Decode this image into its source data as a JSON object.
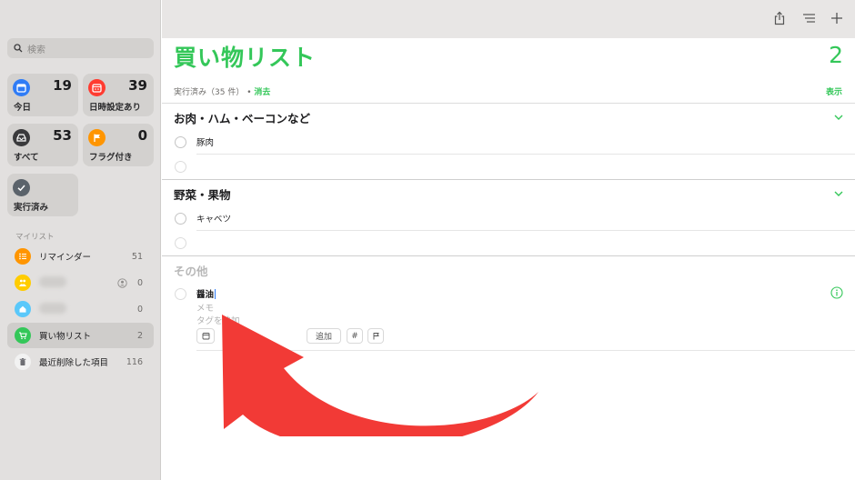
{
  "search": {
    "placeholder": "検索"
  },
  "smart_lists": [
    {
      "label": "今日",
      "count": "19",
      "color": "#2f7cf6",
      "icon": "calendar-icon"
    },
    {
      "label": "日時設定あり",
      "count": "39",
      "color": "#ff3b30",
      "icon": "calendar-grid-icon"
    },
    {
      "label": "すべて",
      "count": "53",
      "color": "#3a3a3c",
      "icon": "tray-icon"
    },
    {
      "label": "フラグ付き",
      "count": "0",
      "color": "#ff9500",
      "icon": "flag-icon"
    },
    {
      "label": "実行済み",
      "count": "",
      "color": "#5b636b",
      "icon": "checkmark-icon"
    }
  ],
  "my_lists_header": "マイリスト",
  "lists": [
    {
      "name": "リマインダー",
      "count": "51",
      "color": "#ff9500",
      "icon": "list-icon"
    },
    {
      "name": "",
      "count": "0",
      "color": "#ffcc00",
      "icon": "people-icon",
      "shared": true
    },
    {
      "name": "",
      "count": "0",
      "color": "#5ac8fa",
      "icon": "house-icon"
    },
    {
      "name": "買い物リスト",
      "count": "2",
      "color": "#34c759",
      "icon": "cart-icon"
    },
    {
      "name": "最近削除した項目",
      "count": "116",
      "color": "#8e8e93",
      "icon": "trash-icon"
    }
  ],
  "main": {
    "title": "買い物リスト",
    "count": "2",
    "completed_label": "実行済み（35 件）",
    "bullet": "•",
    "clear_label": "消去",
    "show_label": "表示"
  },
  "groups": [
    {
      "title": "お肉・ハム・ベーコンなど",
      "items": [
        "豚肉"
      ]
    },
    {
      "title": "野菜・果物",
      "items": [
        "キャベツ"
      ]
    }
  ],
  "other": {
    "title": "その他",
    "item": "醤油",
    "memo_placeholder": "メモ",
    "tag_placeholder": "タグを追加",
    "chip_add": "追加",
    "chip_hash": "#"
  },
  "colors": {
    "accent": "#34c759",
    "arrow": "#f23a36"
  }
}
